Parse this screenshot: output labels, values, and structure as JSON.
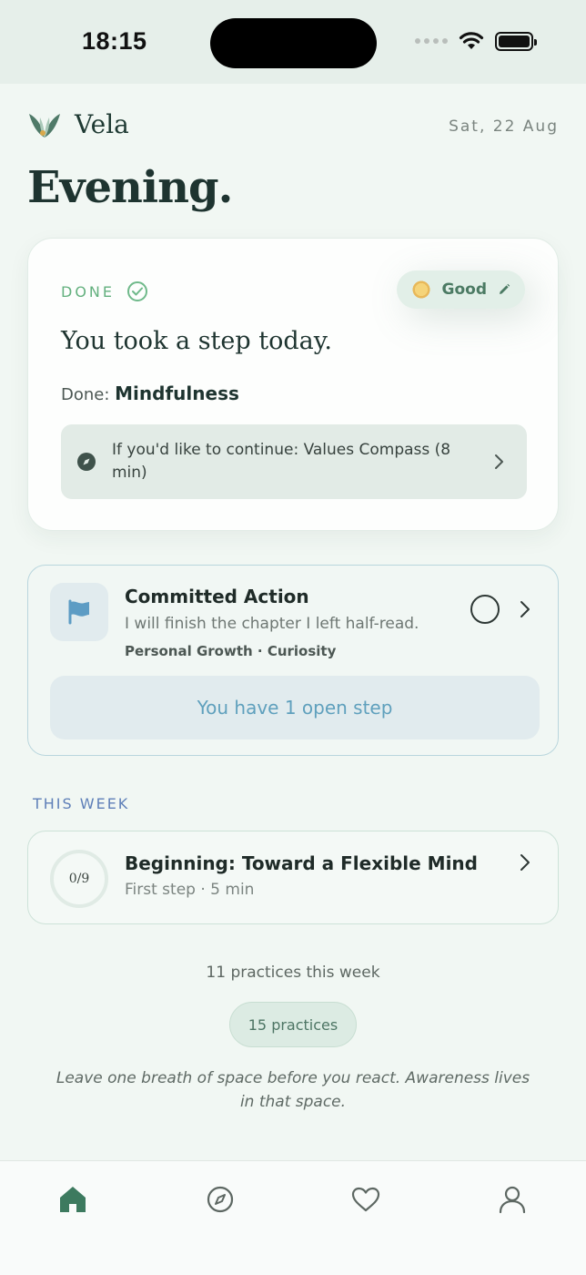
{
  "status_bar": {
    "time": "18:15"
  },
  "header": {
    "brand": "Vela",
    "date": "Sat, 22 Aug",
    "greeting": "Evening."
  },
  "done_card": {
    "status_label": "DONE",
    "mood_label": "Good",
    "title": "You took a step today.",
    "done_prefix": "Done:",
    "done_value": "Mindfulness",
    "continue_text": "If you'd like to continue: Values Compass (8 min)"
  },
  "action_card": {
    "title": "Committed Action",
    "description": "I will finish the chapter I left half-read.",
    "tags": "Personal Growth · Curiosity",
    "open_step": "You have 1 open step"
  },
  "this_week": {
    "section_label": "THIS WEEK",
    "progress_text": "0/9",
    "progress_fraction": 0,
    "title": "Beginning: Toward a Flexible Mind",
    "subtitle": "First step · 5 min"
  },
  "stats": {
    "practices_week": "11 practices this week",
    "practices_pill": "15 practices"
  },
  "quote": "Leave one breath of space before you react. Awareness lives in that space.",
  "tabs": [
    {
      "icon": "home-icon",
      "active": true
    },
    {
      "icon": "compass-icon",
      "active": false
    },
    {
      "icon": "heart-icon",
      "active": false
    },
    {
      "icon": "profile-icon",
      "active": false
    }
  ],
  "colors": {
    "accent_green": "#63b07e",
    "accent_blue": "#5fa0bd",
    "active_tab": "#3d7a5f"
  }
}
